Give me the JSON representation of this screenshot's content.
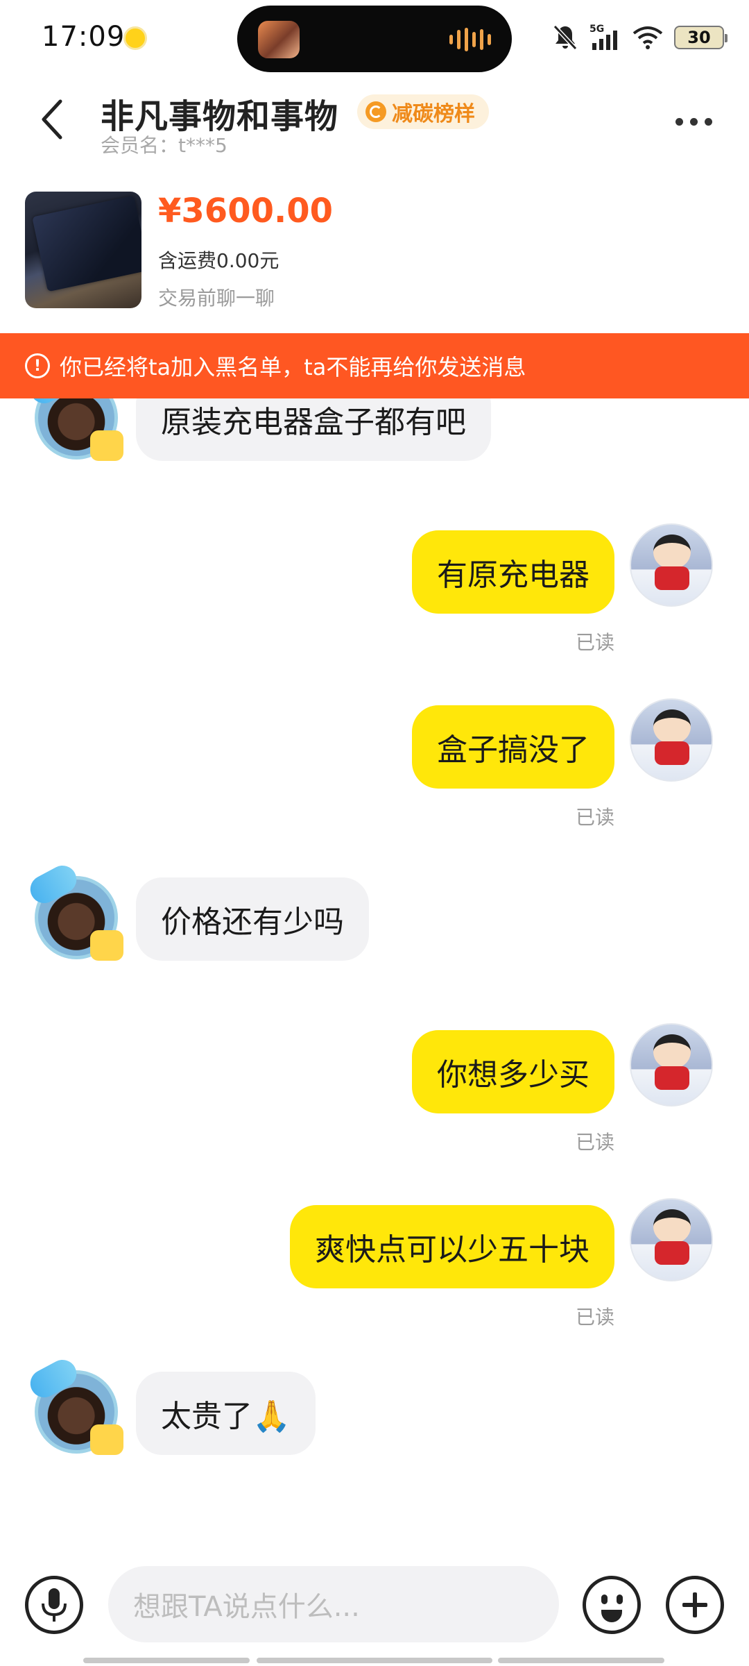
{
  "status_bar": {
    "time": "17:09",
    "network": "5G",
    "battery": "30",
    "icons": [
      "qq-music-icon",
      "mute-icon",
      "signal-icon",
      "wifi-icon",
      "battery-icon"
    ]
  },
  "header": {
    "shop_name": "非凡事物和事物",
    "badge": "减碳榜样",
    "member_label": "会员名：t***5"
  },
  "product": {
    "price": "¥3600.00",
    "shipping": "含运费0.00元",
    "chat_hint": "交易前聊一聊"
  },
  "banner": {
    "icon": "!",
    "text": "你已经将ta加入黑名单，ta不能再给你发送消息"
  },
  "messages": [
    {
      "sender": "other",
      "text": "原装充电器盒子都有吧"
    },
    {
      "sender": "self",
      "text": "有原充电器",
      "status": "已读"
    },
    {
      "sender": "self",
      "text": "盒子搞没了",
      "status": "已读"
    },
    {
      "sender": "other",
      "text": "价格还有少吗"
    },
    {
      "sender": "self",
      "text": "你想多少买",
      "status": "已读"
    },
    {
      "sender": "self",
      "text": "爽快点可以少五十块",
      "status": "已读"
    },
    {
      "sender": "other",
      "text": "太贵了🙏"
    }
  ],
  "input": {
    "placeholder": "想跟TA说点什么..."
  },
  "colors": {
    "accent": "#ff5a1f",
    "banner": "#ff5722",
    "self_bubble": "#ffe70a",
    "other_bubble": "#f2f2f4"
  }
}
